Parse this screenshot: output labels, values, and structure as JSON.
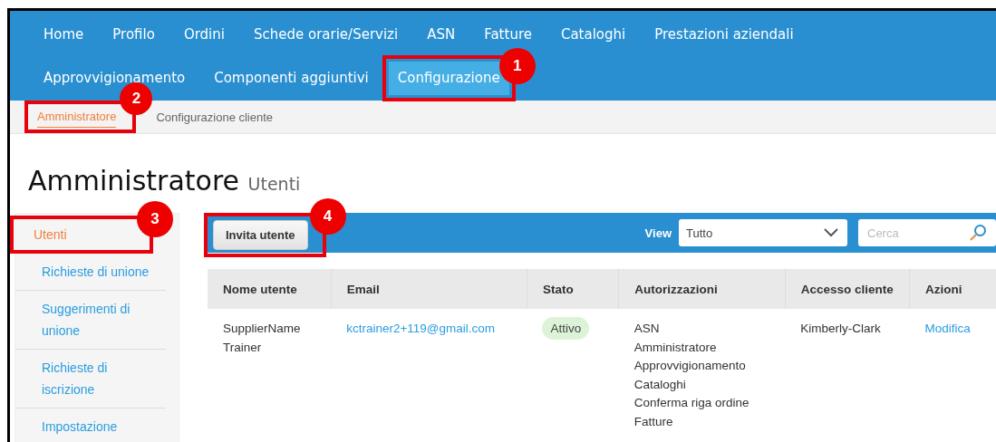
{
  "nav": {
    "items": [
      {
        "label": "Home",
        "selected": false
      },
      {
        "label": "Profilo",
        "selected": false
      },
      {
        "label": "Ordini",
        "selected": false
      },
      {
        "label": "Schede orarie/Servizi",
        "selected": false
      },
      {
        "label": "ASN",
        "selected": false
      },
      {
        "label": "Fatture",
        "selected": false
      },
      {
        "label": "Cataloghi",
        "selected": false
      },
      {
        "label": "Prestazioni aziendali",
        "selected": false
      },
      {
        "label": "Approvvigionamento",
        "selected": false
      },
      {
        "label": "Componenti aggiuntivi",
        "selected": false
      },
      {
        "label": "Configurazione",
        "selected": true,
        "callout": "1"
      }
    ]
  },
  "subnav": {
    "items": [
      {
        "label": "Amministratore",
        "selected": true,
        "callout": "2"
      },
      {
        "label": "Configurazione cliente",
        "selected": false
      }
    ]
  },
  "page_title": {
    "title": "Amministratore",
    "subtitle": "Utenti"
  },
  "sidebar": {
    "items": [
      {
        "label": "Utenti",
        "selected": true,
        "callout": "3"
      },
      {
        "label": "Richieste di unione",
        "selected": false
      },
      {
        "label": "Suggerimenti di unione",
        "selected": false
      },
      {
        "label": "Richieste di iscrizione",
        "selected": false
      },
      {
        "label": "Impostazione",
        "selected": false
      }
    ]
  },
  "toolbar": {
    "button": {
      "label": "Invita utente",
      "callout": "4"
    },
    "view_label": "View",
    "view_value": "Tutto",
    "search": {
      "placeholder": "Cerca"
    }
  },
  "table": {
    "columns": [
      "Nome utente",
      "Email",
      "Stato",
      "Autorizzazioni",
      "Accesso cliente",
      "Azioni"
    ],
    "rows": [
      {
        "name": "SupplierName Trainer",
        "email": "kctrainer2+119@gmail.com",
        "status": "Attivo",
        "permissions": [
          "ASN",
          "Amministratore",
          "Approvvigionamento",
          "Cataloghi",
          "Conferma riga ordine",
          "Fatture"
        ],
        "customer": "Kimberly-Clark",
        "action": "Modifica"
      }
    ]
  }
}
